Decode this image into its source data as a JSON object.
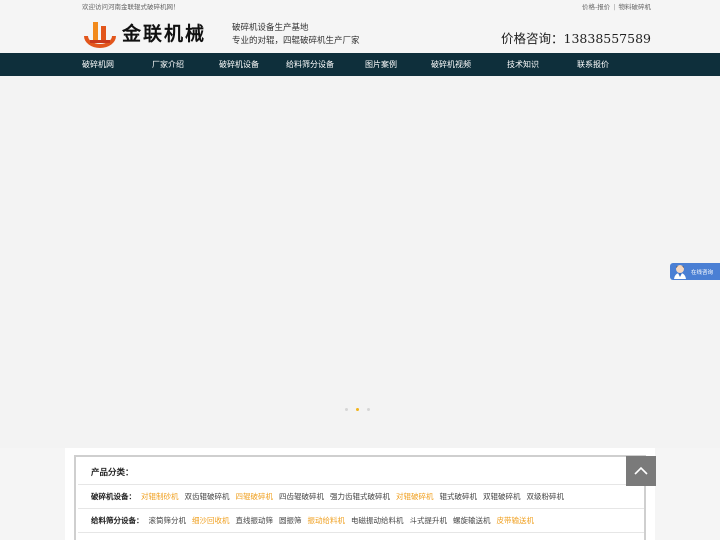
{
  "topbar": {
    "welcome": "欢迎访问河南金联辊式破碎机网！",
    "links": [
      "价格-报价",
      "物料破碎机"
    ]
  },
  "header": {
    "logo_text": "金联机械",
    "slogan_line1": "破碎机设备生产基地",
    "slogan_line2": "专业的对辊，四辊破碎机生产厂家",
    "phone": "价格咨询：13838557589"
  },
  "nav": {
    "items": [
      "破碎机网",
      "厂家介绍",
      "破碎机设备",
      "给料筛分设备",
      "图片案例",
      "破碎机视频",
      "技术知识",
      "联系报价"
    ]
  },
  "chat": {
    "label": "在线咨询"
  },
  "products": {
    "title": "产品分类：",
    "rows": [
      {
        "category": "破碎机设备：",
        "items": [
          {
            "label": "对辊制砂机",
            "highlight": true
          },
          {
            "label": "双齿辊破碎机",
            "highlight": false
          },
          {
            "label": "四辊破碎机",
            "highlight": true
          },
          {
            "label": "四齿辊破碎机",
            "highlight": false
          },
          {
            "label": "强力齿辊式破碎机",
            "highlight": false
          },
          {
            "label": "对辊破碎机",
            "highlight": true
          },
          {
            "label": "辊式破碎机",
            "highlight": false
          },
          {
            "label": "双辊破碎机",
            "highlight": false
          },
          {
            "label": "双级粉碎机",
            "highlight": false
          }
        ]
      },
      {
        "category": "给料筛分设备：",
        "items": [
          {
            "label": "滚筒筛分机",
            "highlight": false
          },
          {
            "label": "细沙回收机",
            "highlight": true
          },
          {
            "label": "直线振动筛",
            "highlight": false
          },
          {
            "label": "圆振筛",
            "highlight": false
          },
          {
            "label": "振动给料机",
            "highlight": true
          },
          {
            "label": "电磁振动给料机",
            "highlight": false
          },
          {
            "label": "斗式提升机",
            "highlight": false
          },
          {
            "label": "螺旋输送机",
            "highlight": false
          },
          {
            "label": "皮带输送机",
            "highlight": true
          }
        ]
      }
    ]
  },
  "colors": {
    "nav_bg": "#0e2f3b",
    "accent": "#f0a020",
    "chat_bg": "#4a7fd4"
  },
  "slider": {
    "active_index": 1,
    "count": 3
  }
}
